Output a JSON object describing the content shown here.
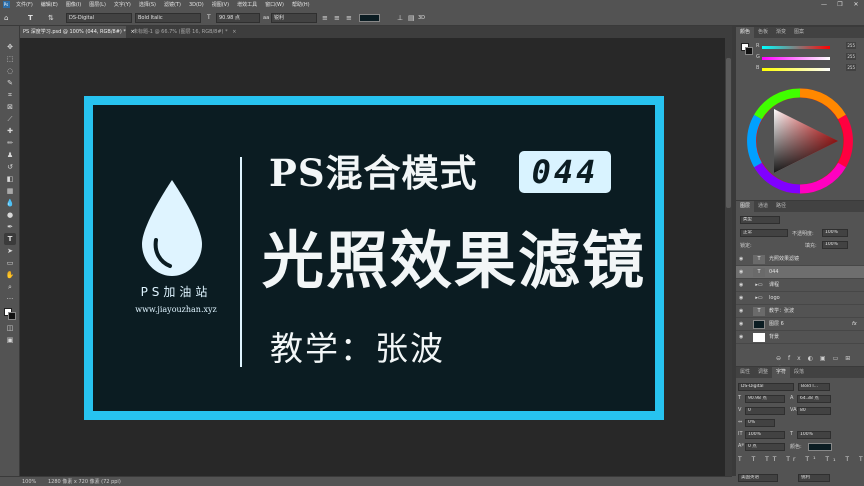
{
  "menubar": {
    "items": [
      "文件(F)",
      "编辑(E)",
      "图像(I)",
      "图层(L)",
      "文字(Y)",
      "选择(S)",
      "滤镜(T)",
      "3D(D)",
      "视图(V)",
      "增效工具",
      "窗口(W)",
      "帮助(H)"
    ],
    "logo": "Ps",
    "minimize": "—",
    "restore": "❐",
    "close": "✕"
  },
  "options": {
    "font_family": "DS-Digital",
    "font_style": "Bold Italic",
    "font_size": "90.98 点",
    "anti_alias": "锐利"
  },
  "tabs": [
    {
      "label": "PS 深度学习.psd @ 100% (044, RGB/8#) *",
      "close": "×"
    },
    {
      "label": "未标题-1 @ 66.7% (图层 16, RGB/8#) *",
      "close": "×"
    }
  ],
  "artwork": {
    "brand": "PS加油站",
    "site": "www.jiayouzhan.xyz",
    "title_line1": "PS混合模式",
    "episode": "044",
    "title_line2": "光照效果滤镜",
    "teacher": "教学：张波"
  },
  "color_panel": {
    "tabs": [
      "颜色",
      "色板",
      "渐变",
      "图案"
    ],
    "sliders": [
      {
        "label": "R",
        "value": "255",
        "gradient": "#ff0000"
      },
      {
        "label": "G",
        "value": "255",
        "gradient": "#00ff00"
      },
      {
        "label": "B",
        "value": "255",
        "gradient": "#0000ff"
      }
    ]
  },
  "layers_panel": {
    "tabs": [
      "图层",
      "通道",
      "路径"
    ],
    "filter_kind": "类型",
    "blend_mode": "正常",
    "opacity_label": "不透明度:",
    "opacity": "100%",
    "lock_label": "锁定:",
    "fill_label": "填充:",
    "fill": "100%",
    "layers": [
      {
        "name": "光照效果滤镜",
        "type": "T",
        "selected": false
      },
      {
        "name": "044",
        "type": "T",
        "selected": true
      },
      {
        "name": "课程",
        "type": "folder",
        "selected": false
      },
      {
        "name": "logo",
        "type": "folder",
        "selected": false
      },
      {
        "name": "教学：张波",
        "type": "T",
        "selected": false
      },
      {
        "name": "图层 6",
        "type": "pixel",
        "selected": false,
        "fx": "fx"
      },
      {
        "name": "背景",
        "type": "pixel",
        "selected": false
      }
    ]
  },
  "char_panel": {
    "tabs": [
      "属性",
      "调整",
      "字符",
      "段落"
    ],
    "font_family": "DS-Digital",
    "font_style": "Bold I...",
    "font_size": "90.98 点",
    "leading": "64.38 点",
    "kerning": "0",
    "tracking": "80",
    "scale_pct": "0%",
    "vscale": "100%",
    "hscale": "100%",
    "baseline": "0 点",
    "color_label": "颜色:",
    "language": "美国英语",
    "aa": "锐利"
  },
  "status": {
    "zoom": "100%",
    "doc_info": "1280 像素 x 720 像素 (72 ppi)"
  }
}
